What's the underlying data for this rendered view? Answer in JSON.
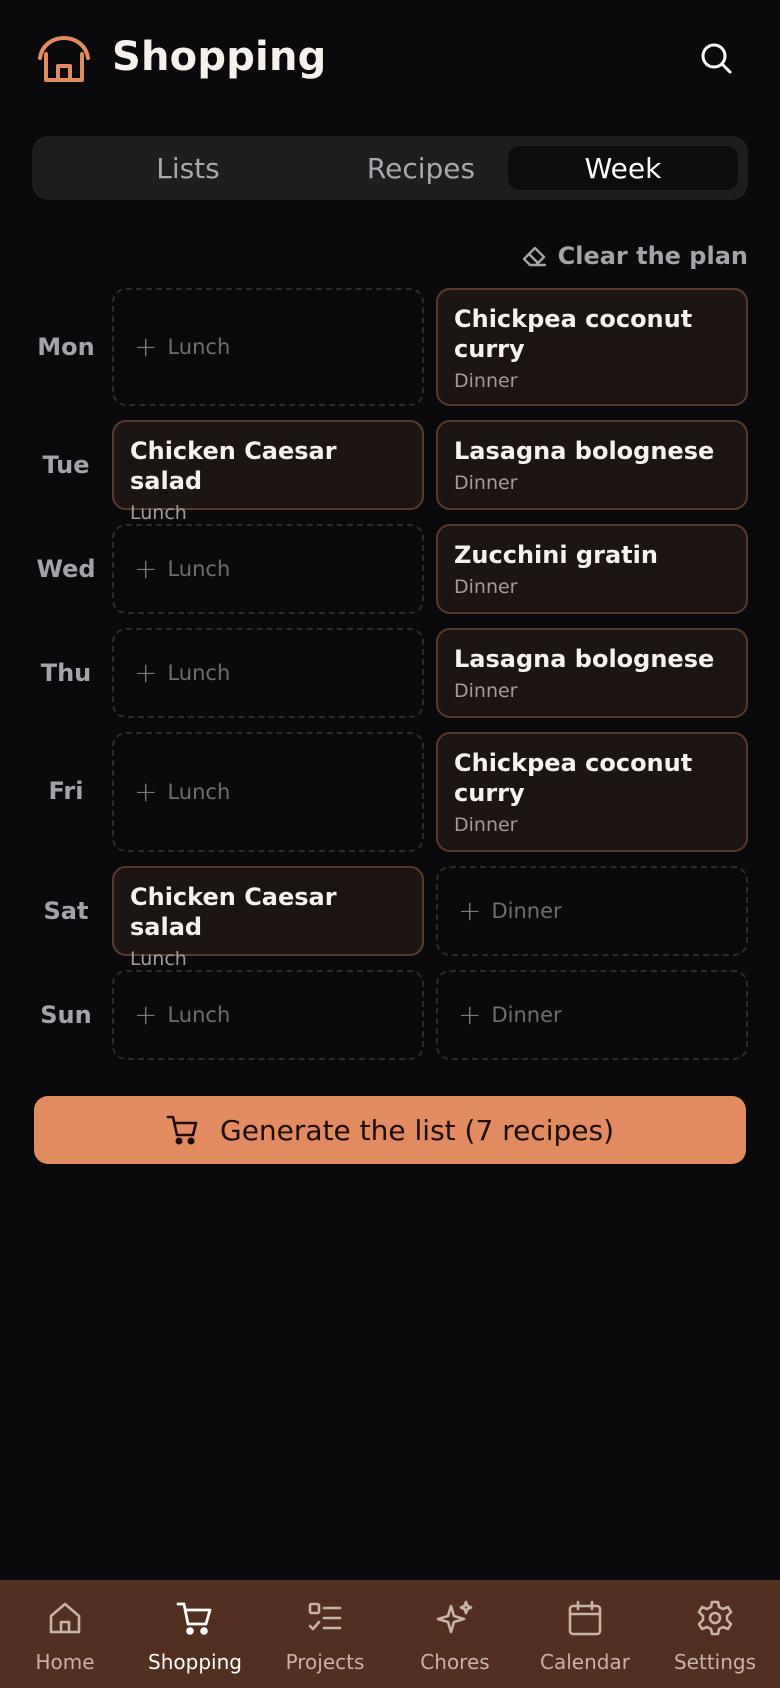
{
  "header": {
    "title": "Shopping",
    "accent_color": "#e38b60"
  },
  "tabs": [
    {
      "label": "Lists",
      "active": false
    },
    {
      "label": "Recipes",
      "active": false
    },
    {
      "label": "Week",
      "active": true
    }
  ],
  "clear_plan_label": "Clear the plan",
  "plan": {
    "days": [
      {
        "day": "Mon",
        "lunch": {
          "filled": false,
          "label": "Lunch"
        },
        "dinner": {
          "filled": true,
          "name": "Chickpea coconut curry",
          "meal": "Dinner"
        }
      },
      {
        "day": "Tue",
        "lunch": {
          "filled": true,
          "name": "Chicken Caesar salad",
          "meal": "Lunch"
        },
        "dinner": {
          "filled": true,
          "name": "Lasagna bolognese",
          "meal": "Dinner"
        }
      },
      {
        "day": "Wed",
        "lunch": {
          "filled": false,
          "label": "Lunch"
        },
        "dinner": {
          "filled": true,
          "name": "Zucchini gratin",
          "meal": "Dinner"
        }
      },
      {
        "day": "Thu",
        "lunch": {
          "filled": false,
          "label": "Lunch"
        },
        "dinner": {
          "filled": true,
          "name": "Lasagna bolognese",
          "meal": "Dinner"
        }
      },
      {
        "day": "Fri",
        "lunch": {
          "filled": false,
          "label": "Lunch"
        },
        "dinner": {
          "filled": true,
          "name": "Chickpea coconut curry",
          "meal": "Dinner"
        }
      },
      {
        "day": "Sat",
        "lunch": {
          "filled": true,
          "name": "Chicken Caesar salad",
          "meal": "Lunch"
        },
        "dinner": {
          "filled": false,
          "label": "Dinner"
        }
      },
      {
        "day": "Sun",
        "lunch": {
          "filled": false,
          "label": "Lunch"
        },
        "dinner": {
          "filled": false,
          "label": "Dinner"
        }
      }
    ]
  },
  "generate_button": {
    "label": "Generate the list (7 recipes)",
    "icon": "cart-icon"
  },
  "bottom_nav": [
    {
      "label": "Home",
      "icon": "home-icon",
      "active": false
    },
    {
      "label": "Shopping",
      "icon": "cart-icon",
      "active": true
    },
    {
      "label": "Projects",
      "icon": "checklist-icon",
      "active": false
    },
    {
      "label": "Chores",
      "icon": "sparkles-icon",
      "active": false
    },
    {
      "label": "Calendar",
      "icon": "calendar-icon",
      "active": false
    },
    {
      "label": "Settings",
      "icon": "gear-icon",
      "active": false
    }
  ]
}
